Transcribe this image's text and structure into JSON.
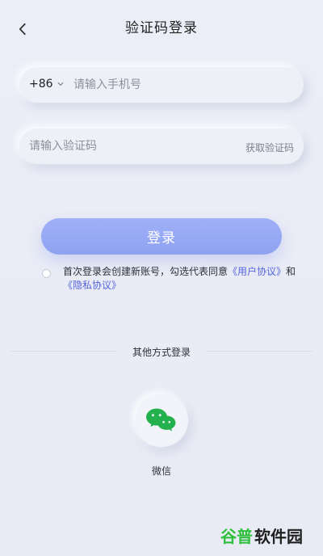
{
  "header": {
    "title": "验证码登录",
    "back_icon": "chevron-left-icon"
  },
  "phone_field": {
    "country_code": "+86",
    "placeholder": "请输入手机号",
    "value": ""
  },
  "code_field": {
    "placeholder": "请输入验证码",
    "value": "",
    "get_code_label": "获取验证码"
  },
  "login_button": {
    "label": "登录",
    "color": "#94a7f4"
  },
  "agreement": {
    "prefix": "首次登录会创建新账号，勾选代表同意",
    "user_agreement": "《用户协议》",
    "connector": "和",
    "privacy_policy": "《隐私协议》"
  },
  "other_login": {
    "label": "其他方式登录",
    "wechat_label": "微信",
    "wechat_icon": "wechat-icon"
  },
  "watermark": {
    "green_text": "谷普",
    "dark_text": "软件园"
  },
  "colors": {
    "background": "#eceef7",
    "accent": "#8fa2f2",
    "link": "#5563da",
    "wechat_green": "#23b14d"
  }
}
